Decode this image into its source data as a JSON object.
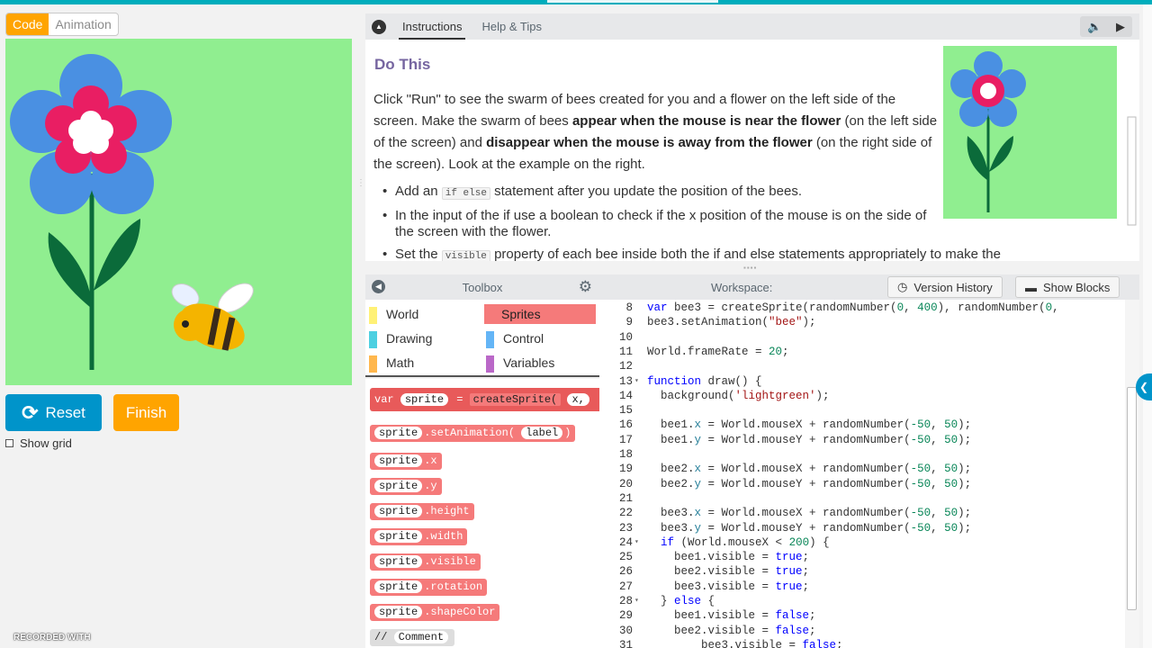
{
  "mode_toggle": {
    "code": "Code",
    "animation": "Animation"
  },
  "controls": {
    "reset": "Reset",
    "finish": "Finish",
    "show_grid": "Show grid"
  },
  "watermark": "RECORDED WITH",
  "instructions": {
    "tabs": [
      "Instructions",
      "Help & Tips"
    ],
    "heading": "Do This",
    "para_1": "Click \"Run\" to see the swarm of bees created for you and a flower on the left side of the screen. Make the swarm of bees ",
    "para_bold_1": "appear when the mouse is near the flower",
    "para_2": " (on the left side of the screen) and ",
    "para_bold_2": "disappear when the mouse is away from the flower",
    "para_3": " (on the right side of the screen). Look at the example on the right.",
    "bullet_1_a": "Add an ",
    "bullet_1_code": "if else",
    "bullet_1_b": " statement after you update the position of the bees.",
    "bullet_2": "In the input of the if use a boolean to check if the x position of the mouse is on the side of the screen with the flower.",
    "bullet_3_a": "Set the ",
    "bullet_3_code": "visible",
    "bullet_3_b": " property of each bee inside both the if and else statements appropriately to make the"
  },
  "toolbox": {
    "title": "Toolbox",
    "categories": [
      {
        "label": "World",
        "color": "#fff176"
      },
      {
        "label": "Sprites",
        "color": "#f57a7a"
      },
      {
        "label": "Drawing",
        "color": "#4dd0e1"
      },
      {
        "label": "Control",
        "color": "#64b5f6"
      },
      {
        "label": "Math",
        "color": "#ffb74d"
      },
      {
        "label": "Variables",
        "color": "#ba68c8"
      }
    ],
    "blocks": {
      "var_kw": "var",
      "sprite": "sprite",
      "eq": "=",
      "create": "createSprite(",
      "x": "x,",
      "set_anim": ".setAnimation(",
      "label": "label",
      "close": ")",
      "dot_x": ".x",
      "dot_y": ".y",
      "height": ".height",
      "width": ".width",
      "visible": ".visible",
      "rotation": ".rotation",
      "shape_color": ".shapeColor",
      "comment_slash": "//",
      "comment": "Comment"
    }
  },
  "workspace": {
    "title": "Workspace:",
    "version_history": "Version History",
    "show_blocks": "Show Blocks"
  },
  "code_lines": [
    {
      "n": "8",
      "t": "var bee3 = createSprite(randomNumber(0, 400), randomNumber(0,"
    },
    {
      "n": "9",
      "t": "bee3.setAnimation(\"bee\");"
    },
    {
      "n": "10",
      "t": ""
    },
    {
      "n": "11",
      "t": "World.frameRate = 20;"
    },
    {
      "n": "12",
      "t": ""
    },
    {
      "n": "13",
      "t": "function draw() {"
    },
    {
      "n": "14",
      "t": "  background('lightgreen');"
    },
    {
      "n": "15",
      "t": ""
    },
    {
      "n": "16",
      "t": "  bee1.x = World.mouseX + randomNumber(-50, 50);"
    },
    {
      "n": "17",
      "t": "  bee1.y = World.mouseY + randomNumber(-50, 50);"
    },
    {
      "n": "18",
      "t": ""
    },
    {
      "n": "19",
      "t": "  bee2.x = World.mouseX + randomNumber(-50, 50);"
    },
    {
      "n": "20",
      "t": "  bee2.y = World.mouseY + randomNumber(-50, 50);"
    },
    {
      "n": "21",
      "t": ""
    },
    {
      "n": "22",
      "t": "  bee3.x = World.mouseX + randomNumber(-50, 50);"
    },
    {
      "n": "23",
      "t": "  bee3.y = World.mouseY + randomNumber(-50, 50);"
    },
    {
      "n": "24",
      "t": "  if (World.mouseX < 200) {"
    },
    {
      "n": "25",
      "t": "    bee1.visible = true;"
    },
    {
      "n": "26",
      "t": "    bee2.visible = true;"
    },
    {
      "n": "27",
      "t": "    bee3.visible = true;"
    },
    {
      "n": "28",
      "t": "  } else {"
    },
    {
      "n": "29",
      "t": "    bee1.visible = false;"
    },
    {
      "n": "30",
      "t": "    bee2.visible = false;"
    },
    {
      "n": "31",
      "t": "        bee3.visible = false;"
    }
  ],
  "colors": {
    "accent_teal": "#00adbc",
    "reset_blue": "#0094ca",
    "finish_orange": "#ffa400",
    "sprite_red": "#f57a7a",
    "stage_green": "#90ee90",
    "heading_purple": "#7665a0"
  }
}
